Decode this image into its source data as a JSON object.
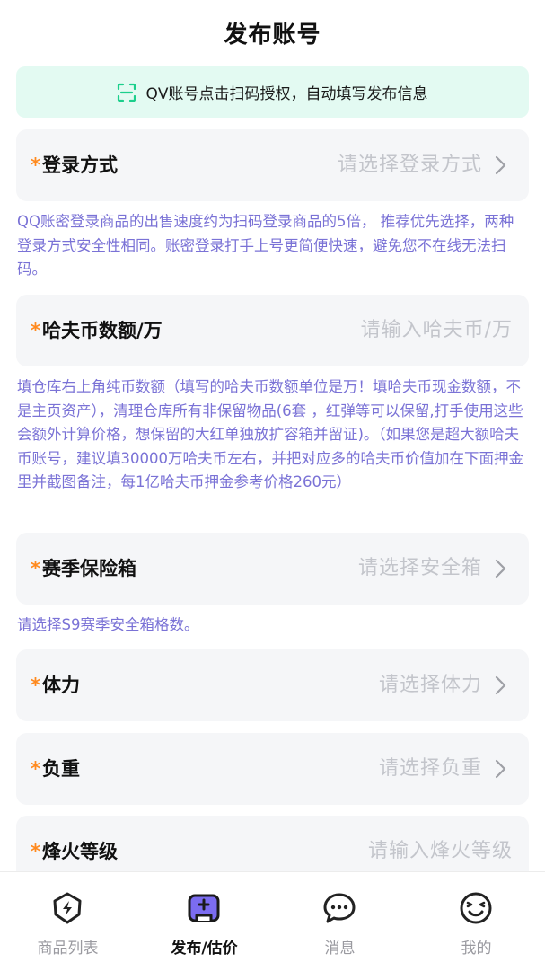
{
  "header": {
    "title": "发布账号"
  },
  "scan_banner": {
    "text": "QV账号点击扫码授权，自动填写发布信息"
  },
  "fields": [
    {
      "label": "登录方式",
      "placeholder": "请选择登录方式",
      "required": "*"
    },
    {
      "label": "哈夫币数额/万",
      "placeholder": "请输入哈夫币/万",
      "required": "*"
    },
    {
      "label": "赛季保险箱",
      "placeholder": "请选择安全箱",
      "required": "*"
    },
    {
      "label": "体力",
      "placeholder": "请选择体力",
      "required": "*"
    },
    {
      "label": "负重",
      "placeholder": "请选择负重",
      "required": "*"
    },
    {
      "label": "烽火等级",
      "placeholder": "请输入烽火等级",
      "required": "*"
    }
  ],
  "notes": {
    "login": "QQ账密登录商品的出售速度约为扫码登录商品的5倍， 推荐优先选择，两种登录方式安全性相同。账密登录打手上号更简便快速，避免您不在线无法扫码。",
    "coins": "填仓库右上角纯币数额（填写的哈夫币数额单位是万！填哈夫币现金数额，不是主页资产），清理仓库所有非保留物品(6套 ，红弹等可以保留,打手使用这些会额外计算价格，想保留的大红单独放扩容箱并留证)。（如果您是超大额哈夫币账号，建议填30000万哈夫币左右，并把对应多的哈夫币价值加在下面押金里并截图备注，每1亿哈夫币押金参考价格260元）",
    "safebox": "请选择S9赛季安全箱格数。"
  },
  "tabbar": {
    "items": [
      {
        "label": "商品列表",
        "icon": "lightning-shield-icon"
      },
      {
        "label": "发布/估价",
        "icon": "publish-gamepad-icon"
      },
      {
        "label": "消息",
        "icon": "chat-bubble-icon"
      },
      {
        "label": "我的",
        "icon": "smiley-icon"
      }
    ],
    "active_index": 1,
    "accent_color": "#7b6cf0"
  },
  "colors": {
    "note_text": "#7a72d6",
    "required_star": "#ff8a1f",
    "banner_bg": "#e3faf2",
    "scan_icon": "#1ccf8c"
  }
}
